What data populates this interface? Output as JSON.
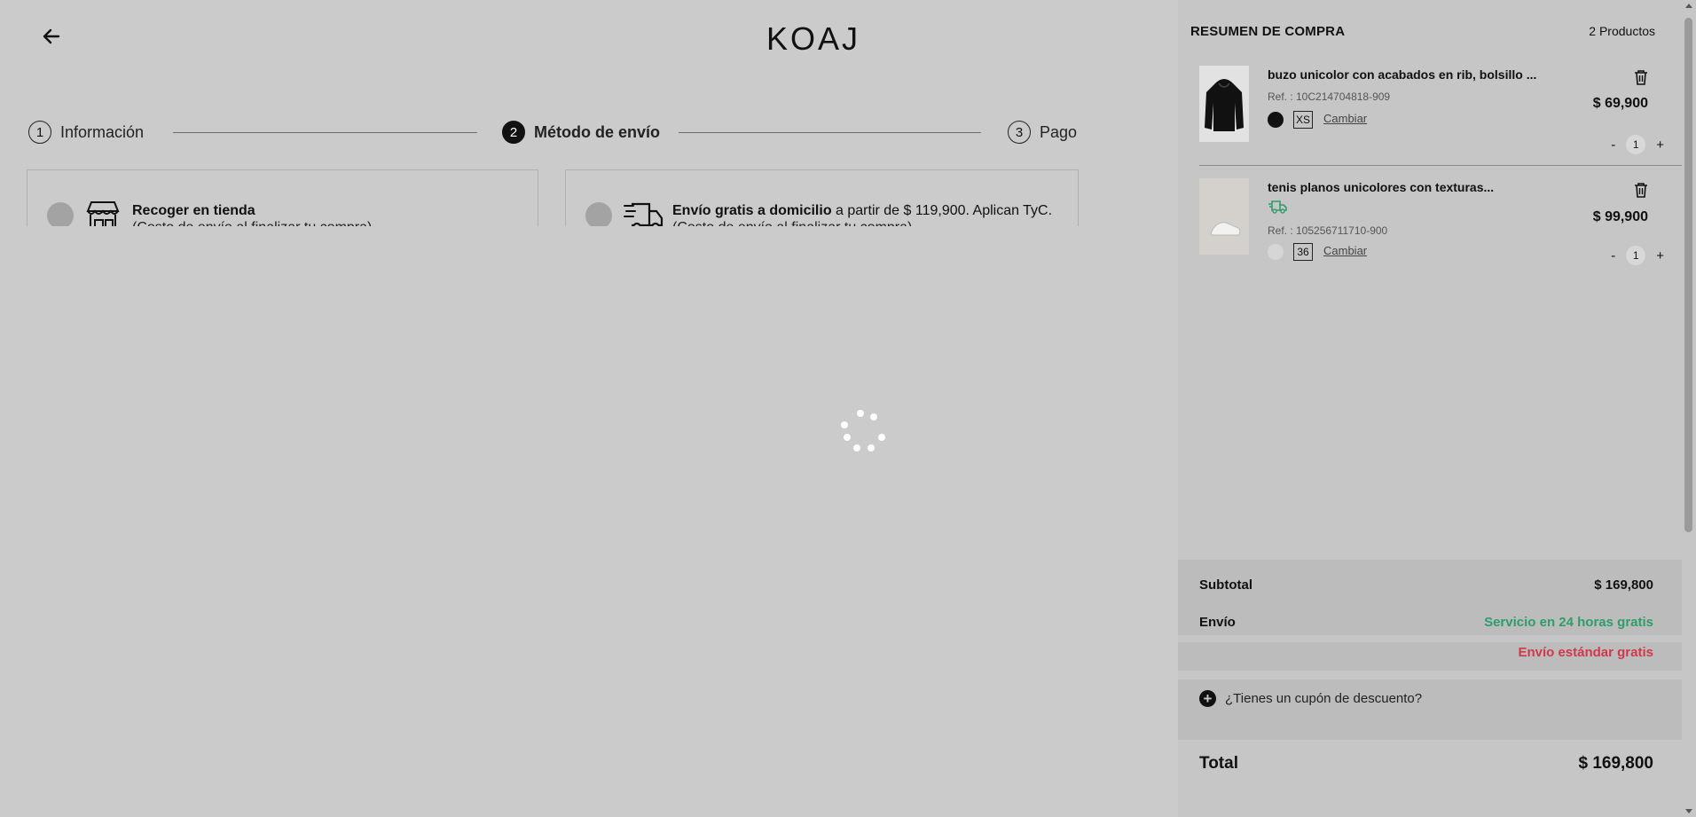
{
  "header": {
    "logo": "KOAJ"
  },
  "steps": [
    {
      "num": "1",
      "label": "Información"
    },
    {
      "num": "2",
      "label": "Método de envío"
    },
    {
      "num": "3",
      "label": "Pago"
    }
  ],
  "shipping": {
    "pickup": {
      "title": "Recoger en tienda",
      "sub": "(Costo de envío al finalizar tu compra)"
    },
    "delivery": {
      "title": "Envío gratis a domicilio",
      "rest": " a partir de $ 119,900. Aplican TyC.",
      "sub": "(Costo de envío al finalizar tu compra)"
    }
  },
  "summary": {
    "title": "RESUMEN DE COMPRA",
    "count": "2 Productos",
    "items": [
      {
        "name": "buzo unicolor con acabados en rib, bolsillo ...",
        "ref": "Ref. : 10C214704818-909",
        "color": "#111111",
        "size": "XS",
        "change": "Cambiar",
        "price": "$ 69,900",
        "qty": "1"
      },
      {
        "name": "tenis planos unicolores con texturas...",
        "ref": "Ref. : 105256711710-900",
        "color": "#d6d6d6",
        "size": "36",
        "change": "Cambiar",
        "price": "$ 99,900",
        "qty": "1"
      }
    ],
    "qty_minus": "-",
    "qty_plus": "+",
    "subtotal_label": "Subtotal",
    "subtotal_value": "$ 169,800",
    "shipping_label": "Envío",
    "shipping_value_1": "Servicio en 24 horas gratis",
    "shipping_value_2": "Envío estándar gratis",
    "coupon": "¿Tienes un cupón de descuento?",
    "total_label": "Total",
    "total_value": "$ 169,800"
  },
  "colors": {
    "accent_green": "#2f9d69",
    "accent_red": "#d1384a",
    "overlay_gray": "#cbcbcb"
  }
}
